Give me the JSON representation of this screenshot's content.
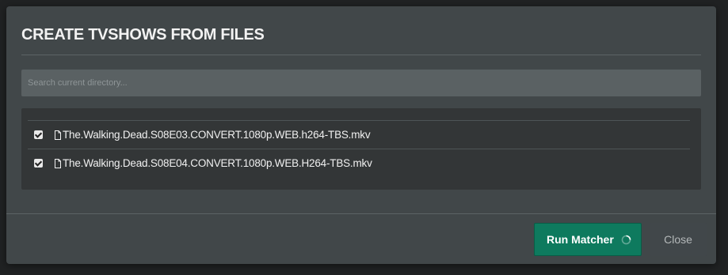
{
  "dialog": {
    "title": "CREATE TVSHOWS FROM FILES",
    "search": {
      "placeholder": "Search current directory...",
      "value": ""
    },
    "files": [
      {
        "name": "The.Walking.Dead.S08E03.CONVERT.1080p.WEB.h264-TBS.mkv",
        "checked": true,
        "icon": "file-icon"
      },
      {
        "name": "The.Walking.Dead.S08E04.CONVERT.1080p.WEB.H264-TBS.mkv",
        "checked": true,
        "icon": "file-icon"
      }
    ],
    "footer": {
      "run_label": "Run Matcher",
      "run_icon": "spinner-icon",
      "close_label": "Close"
    }
  },
  "colors": {
    "modal_bg": "#414749",
    "panel_bg": "#333637",
    "input_bg": "#5a6163",
    "accent": "#0e7a5e"
  }
}
